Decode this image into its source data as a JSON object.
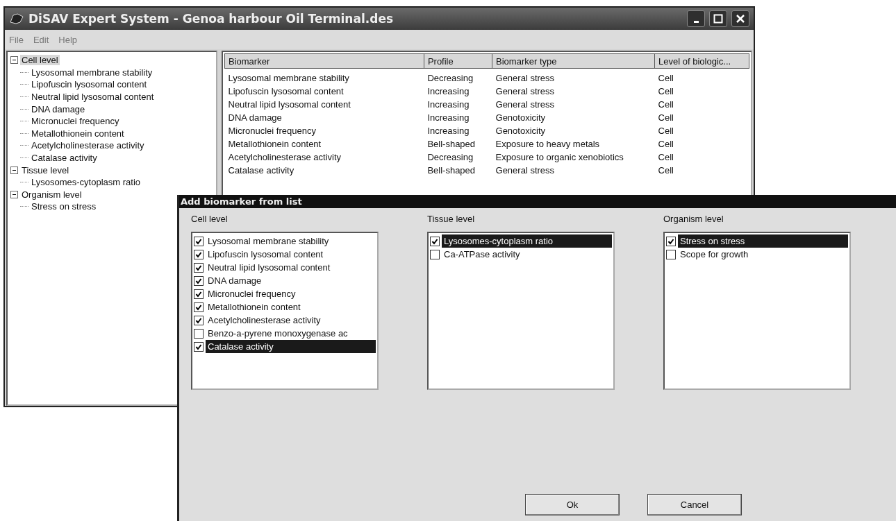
{
  "window": {
    "title": "DiSAV Expert System - Genoa harbour Oil Terminal.des"
  },
  "menu": [
    "File",
    "Edit",
    "Help"
  ],
  "tree": [
    {
      "label": "Cell level",
      "expanded": true,
      "selected": true,
      "children": [
        {
          "label": "Lysosomal membrane stability",
          "selected": false
        },
        {
          "label": "Lipofuscin lysosomal content",
          "selected": false
        },
        {
          "label": "Neutral lipid lysosomal content",
          "selected": false
        },
        {
          "label": "DNA damage",
          "selected": false
        },
        {
          "label": "Micronuclei frequency",
          "selected": false
        },
        {
          "label": "Metallothionein content",
          "selected": false
        },
        {
          "label": "Acetylcholinesterase activity",
          "selected": false
        },
        {
          "label": "Catalase activity",
          "selected": false
        }
      ]
    },
    {
      "label": "Tissue level",
      "expanded": true,
      "selected": false,
      "children": [
        {
          "label": "Lysosomes-cytoplasm ratio",
          "selected": false
        }
      ]
    },
    {
      "label": "Organism level",
      "expanded": true,
      "selected": false,
      "children": [
        {
          "label": "Stress on stress",
          "selected": false
        }
      ]
    }
  ],
  "table": {
    "columns": [
      "Biomarker",
      "Profile",
      "Biomarker type",
      "Level of biologic..."
    ],
    "rows": [
      [
        "Lysosomal membrane stability",
        "Decreasing",
        "General stress",
        "Cell"
      ],
      [
        "Lipofuscin lysosomal content",
        "Increasing",
        "General stress",
        "Cell"
      ],
      [
        "Neutral lipid lysosomal content",
        "Increasing",
        "General stress",
        "Cell"
      ],
      [
        "DNA damage",
        "Increasing",
        "Genotoxicity",
        "Cell"
      ],
      [
        "Micronuclei frequency",
        "Increasing",
        "Genotoxicity",
        "Cell"
      ],
      [
        "Metallothionein content",
        "Bell-shaped",
        "Exposure to heavy metals",
        "Cell"
      ],
      [
        "Acetylcholinesterase activity",
        "Decreasing",
        "Exposure to organic xenobiotics",
        "Cell"
      ],
      [
        "Catalase activity",
        "Bell-shaped",
        "General stress",
        "Cell"
      ]
    ]
  },
  "dialog": {
    "title": "Add biomarker from list",
    "lists": [
      {
        "label": "Cell level",
        "items": [
          {
            "label": "Lysosomal membrane stability",
            "checked": true,
            "selected": false
          },
          {
            "label": "Lipofuscin lysosomal content",
            "checked": true,
            "selected": false
          },
          {
            "label": "Neutral lipid lysosomal content",
            "checked": true,
            "selected": false
          },
          {
            "label": "DNA damage",
            "checked": true,
            "selected": false
          },
          {
            "label": "Micronuclei frequency",
            "checked": true,
            "selected": false
          },
          {
            "label": "Metallothionein content",
            "checked": true,
            "selected": false
          },
          {
            "label": "Acetylcholinesterase activity",
            "checked": true,
            "selected": false
          },
          {
            "label": "Benzo-a-pyrene monoxygenase ac",
            "checked": false,
            "selected": false
          },
          {
            "label": "Catalase activity",
            "checked": true,
            "selected": true
          }
        ]
      },
      {
        "label": "Tissue level",
        "items": [
          {
            "label": "Lysosomes-cytoplasm ratio",
            "checked": true,
            "selected": true
          },
          {
            "label": "Ca-ATPase activity",
            "checked": false,
            "selected": false
          }
        ]
      },
      {
        "label": "Organism level",
        "items": [
          {
            "label": "Stress on stress",
            "checked": true,
            "selected": true
          },
          {
            "label": "Scope for growth",
            "checked": false,
            "selected": false
          }
        ]
      }
    ],
    "buttons": [
      "Ok",
      "Cancel"
    ]
  }
}
